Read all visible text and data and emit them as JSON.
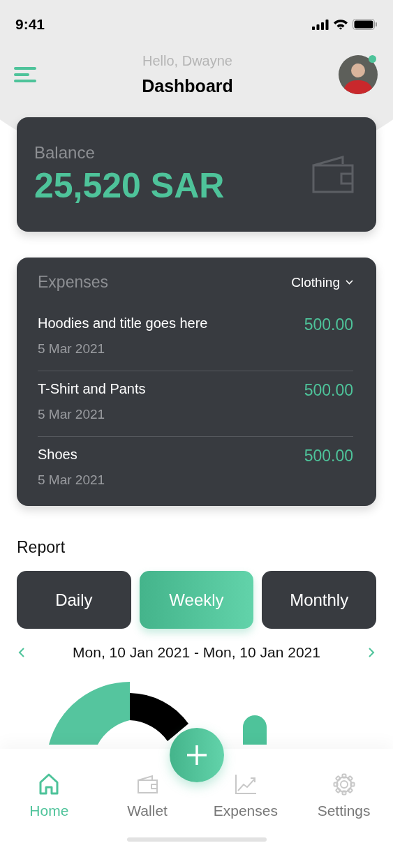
{
  "status_bar": {
    "time": "9:41"
  },
  "header": {
    "greeting": "Hello, Dwayne",
    "title": "Dashboard",
    "avatar": {
      "online": true
    }
  },
  "balance": {
    "label": "Balance",
    "amount": "25,520 SAR"
  },
  "expenses": {
    "title": "Expenses",
    "filter": "Clothing",
    "items": [
      {
        "name": "Hoodies and title goes here",
        "date": "5 Mar 2021",
        "amount": "500.00"
      },
      {
        "name": "T-Shirt and Pants",
        "date": "5 Mar 2021",
        "amount": "500.00"
      },
      {
        "name": "Shoes",
        "date": "5 Mar 2021",
        "amount": "500.00"
      }
    ]
  },
  "report": {
    "title": "Report",
    "periods": [
      {
        "label": "Daily",
        "selected": false
      },
      {
        "label": "Weekly",
        "selected": true
      },
      {
        "label": "Monthly",
        "selected": false
      }
    ],
    "range": "Mon, 10 Jan 2021 - Mon, 10 Jan 2021"
  },
  "nav": [
    {
      "kind": "home",
      "label": "Home",
      "selected": true
    },
    {
      "kind": "wallet",
      "label": "Wallet",
      "selected": false
    },
    {
      "kind": "expenses",
      "label": "Expenses",
      "selected": false
    },
    {
      "kind": "settings",
      "label": "Settings",
      "selected": false
    }
  ]
}
